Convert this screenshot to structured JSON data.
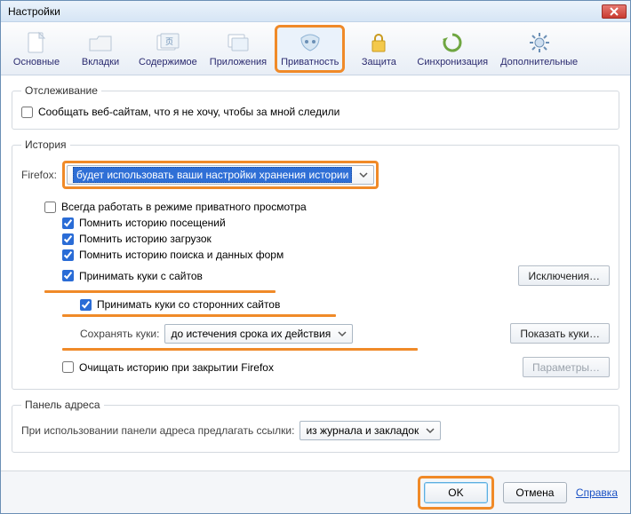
{
  "window": {
    "title": "Настройки"
  },
  "tabs": {
    "general": "Основные",
    "tabs": "Вкладки",
    "content": "Содержимое",
    "applications": "Приложения",
    "privacy": "Приватность",
    "security": "Защита",
    "sync": "Синхронизация",
    "advanced": "Дополнительные"
  },
  "tracking": {
    "legend": "Отслеживание",
    "do_not_track": "Сообщать веб-сайтам, что я не хочу, чтобы за мной следили"
  },
  "history": {
    "legend": "История",
    "firefox_label": "Firefox:",
    "mode_selected": "будет использовать ваши настройки хранения истории",
    "always_private": "Всегда работать в режиме приватного просмотра",
    "remember_browsing": "Помнить историю посещений",
    "remember_downloads": "Помнить историю загрузок",
    "remember_search_form": "Помнить историю поиска и данных форм",
    "accept_cookies": "Принимать куки с сайтов",
    "exceptions_btn": "Исключения…",
    "accept_third_party": "Принимать куки со сторонних сайтов",
    "keep_cookies_label": "Сохранять куки:",
    "keep_cookies_selected": "до истечения срока их действия",
    "show_cookies_btn": "Показать куки…",
    "clear_on_close": "Очищать историю при закрытии Firefox",
    "settings_btn": "Параметры…"
  },
  "locationbar": {
    "legend": "Панель адреса",
    "suggest_label": "При использовании панели адреса предлагать ссылки:",
    "suggest_selected": "из журнала и закладок"
  },
  "footer": {
    "ok": "OK",
    "cancel": "Отмена",
    "help": "Справка"
  }
}
